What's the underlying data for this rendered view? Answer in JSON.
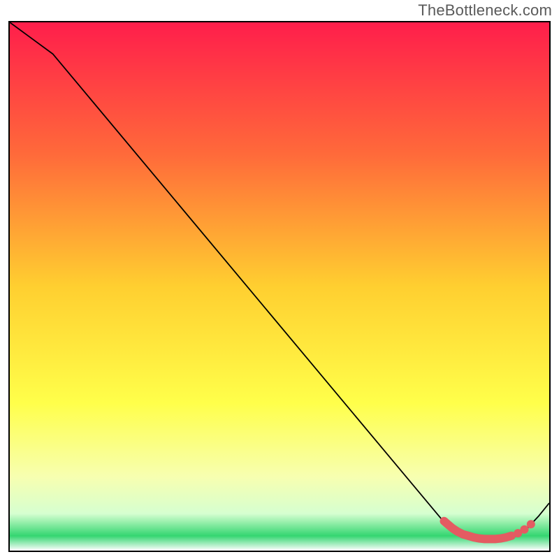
{
  "watermark": "TheBottleneck.com",
  "chart_data": {
    "type": "line",
    "title": "",
    "xlabel": "",
    "ylabel": "",
    "xlim": [
      0,
      100
    ],
    "ylim": [
      0,
      100
    ],
    "grid": false,
    "legend": false,
    "background_gradient": [
      {
        "stop": 0.0,
        "color": "#ff1e4b"
      },
      {
        "stop": 0.25,
        "color": "#ff6a3a"
      },
      {
        "stop": 0.5,
        "color": "#ffcf30"
      },
      {
        "stop": 0.72,
        "color": "#ffff4a"
      },
      {
        "stop": 0.86,
        "color": "#f7ffb0"
      },
      {
        "stop": 0.93,
        "color": "#d6ffd0"
      },
      {
        "stop": 0.972,
        "color": "#34d671"
      },
      {
        "stop": 1.0,
        "color": "#ffffff"
      }
    ],
    "series": [
      {
        "name": "bottleneck-curve",
        "x": [
          0,
          4,
          8,
          80,
          82,
          84,
          86,
          88,
          90,
          92,
          94,
          96,
          98,
          100
        ],
        "y": [
          100,
          97,
          94,
          6,
          4,
          2.6,
          2.2,
          2.1,
          2.1,
          2.2,
          2.8,
          4.3,
          6.5,
          9.0
        ]
      }
    ],
    "markers": {
      "name": "highlight-region",
      "x": [
        80.5,
        81.3,
        82.1,
        83.0,
        84.0,
        85.0,
        86.0,
        87.0,
        88.0,
        89.0,
        90.0,
        91.0,
        92.0,
        93.0,
        94.2,
        95.4,
        96.6
      ],
      "y": [
        5.6,
        4.9,
        4.2,
        3.6,
        3.1,
        2.8,
        2.5,
        2.3,
        2.2,
        2.2,
        2.2,
        2.3,
        2.5,
        2.8,
        3.3,
        4.0,
        5.0
      ]
    }
  }
}
